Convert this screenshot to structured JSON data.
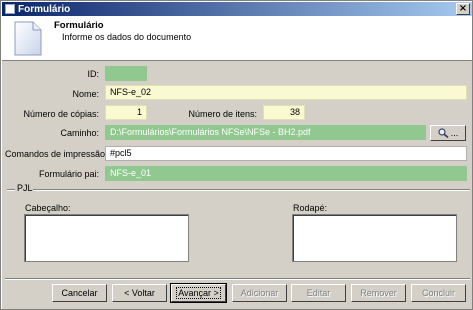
{
  "window": {
    "title": "Formulário"
  },
  "header": {
    "title": "Formulário",
    "subtitle": "Informe os dados do documento"
  },
  "form": {
    "id_label": "ID:",
    "id_value": "",
    "nome_label": "Nome:",
    "nome_value": "NFS-e_02",
    "copias_label": "Número de cópias:",
    "copias_value": "1",
    "itens_label": "Número de itens:",
    "itens_value": "38",
    "caminho_label": "Caminho:",
    "caminho_value": "D:\\Formulários\\Formulários NFSe\\NFSe - BH2.pdf",
    "browse_label": "...",
    "comandos_label": "Comandos de impressão:",
    "comandos_value": "#pcl5",
    "pai_label": "Formulário pai:",
    "pai_value": "NFS-e_01"
  },
  "pjl": {
    "group_label": "PJL",
    "cabecalho_label": "Cabeçalho:",
    "rodape_label": "Rodapé:"
  },
  "buttons": {
    "cancelar": "Cancelar",
    "voltar": "< Voltar",
    "avancar": "Avançar >",
    "adicionar": "Adicionar",
    "editar": "Editar",
    "remover": "Remover",
    "concluir": "Concluir"
  },
  "colors": {
    "title_bar": "#0a246a",
    "required_field": "#fafad2",
    "readonly_field": "#90c890"
  }
}
